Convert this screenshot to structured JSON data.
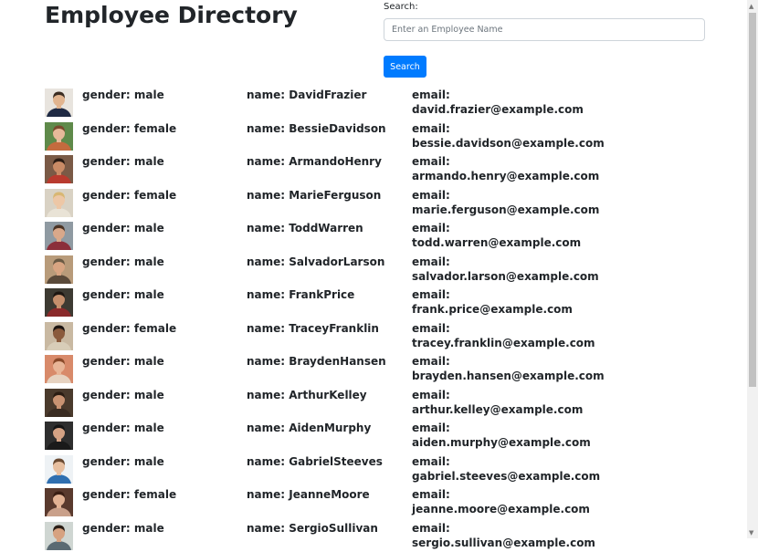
{
  "page": {
    "title": "Employee Directory"
  },
  "search": {
    "label": "Search:",
    "placeholder": "Enter an Employee Name",
    "button_label": "Search"
  },
  "field_labels": {
    "gender": "gender: ",
    "name": "name: ",
    "email": "email:"
  },
  "employees": [
    {
      "gender": "male",
      "name": "DavidFrazier",
      "email": "david.frazier@example.com",
      "avatar_colors": {
        "bg": "#e8e4de",
        "skin": "#e1b48f",
        "hair": "#3a2c22",
        "shirt": "#1f2a44"
      }
    },
    {
      "gender": "female",
      "name": "BessieDavidson",
      "email": "bessie.davidson@example.com",
      "avatar_colors": {
        "bg": "#5f8a4a",
        "skin": "#e7b99a",
        "hair": "#7a4a2c",
        "shirt": "#c46b3e"
      }
    },
    {
      "gender": "male",
      "name": "ArmandoHenry",
      "email": "armando.henry@example.com",
      "avatar_colors": {
        "bg": "#7a5a46",
        "skin": "#c98b66",
        "hair": "#2c1d15",
        "shirt": "#b93a2e"
      }
    },
    {
      "gender": "female",
      "name": "MarieFerguson",
      "email": "marie.ferguson@example.com",
      "avatar_colors": {
        "bg": "#d9d2c4",
        "skin": "#edc7a6",
        "hair": "#d8b773",
        "shirt": "#e9e3d6"
      }
    },
    {
      "gender": "male",
      "name": "ToddWarren",
      "email": "todd.warren@example.com",
      "avatar_colors": {
        "bg": "#8f9aa2",
        "skin": "#d9a88a",
        "hair": "#4a3324",
        "shirt": "#8b2f3a"
      }
    },
    {
      "gender": "male",
      "name": "SalvadorLarson",
      "email": "salvador.larson@example.com",
      "avatar_colors": {
        "bg": "#b89b7a",
        "skin": "#d8a582",
        "hair": "#6a5a44",
        "shirt": "#5a4a3a"
      }
    },
    {
      "gender": "male",
      "name": "FrankPrice",
      "email": "frank.price@example.com",
      "avatar_colors": {
        "bg": "#3d3a32",
        "skin": "#c58f6c",
        "hair": "#1e1712",
        "shirt": "#8a2a2a"
      }
    },
    {
      "gender": "female",
      "name": "TraceyFranklin",
      "email": "tracey.franklin@example.com",
      "avatar_colors": {
        "bg": "#c9b9a2",
        "skin": "#8a5a3c",
        "hair": "#1c1410",
        "shirt": "#d8cdb8"
      }
    },
    {
      "gender": "male",
      "name": "BraydenHansen",
      "email": "brayden.hansen@example.com",
      "avatar_colors": {
        "bg": "#d88a6a",
        "skin": "#e8b597",
        "hair": "#8a4a2a",
        "shirt": "#e6d2c0"
      }
    },
    {
      "gender": "male",
      "name": "ArthurKelley",
      "email": "arthur.kelley@example.com",
      "avatar_colors": {
        "bg": "#4a3a2c",
        "skin": "#c99372",
        "hair": "#2a1c12",
        "shirt": "#3a2c22"
      }
    },
    {
      "gender": "male",
      "name": "AidenMurphy",
      "email": "aiden.murphy@example.com",
      "avatar_colors": {
        "bg": "#2e2e2e",
        "skin": "#d4a284",
        "hair": "#141414",
        "shirt": "#1a1a1a"
      }
    },
    {
      "gender": "male",
      "name": "GabrielSteeves",
      "email": "gabriel.steeves@example.com",
      "avatar_colors": {
        "bg": "#eef2f5",
        "skin": "#e7bfa0",
        "hair": "#6a4a32",
        "shirt": "#2f6fb0"
      }
    },
    {
      "gender": "female",
      "name": "JeanneMoore",
      "email": "jeanne.moore@example.com",
      "avatar_colors": {
        "bg": "#5a3a2e",
        "skin": "#e2b294",
        "hair": "#3a1e14",
        "shirt": "#c9a08a"
      }
    },
    {
      "gender": "male",
      "name": "SergioSullivan",
      "email": "sergio.sullivan@example.com",
      "avatar_colors": {
        "bg": "#cfd6d2",
        "skin": "#d6a281",
        "hair": "#2a1e16",
        "shirt": "#5a6a72"
      }
    }
  ]
}
